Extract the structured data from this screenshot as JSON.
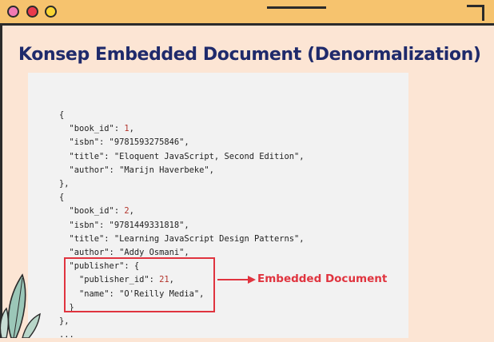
{
  "slide": {
    "title": "Konsep Embedded Document (Denormalization)",
    "annotation": "Embedded Document"
  },
  "code_lines": [
    "{",
    "  \"book_id\": 1,",
    "  \"isbn\": \"9781593275846\",",
    "  \"title\": \"Eloquent JavaScript, Second Edition\",",
    "  \"author\": \"Marijn Haverbeke\",",
    "},",
    "{",
    "  \"book_id\": 2,",
    "  \"isbn\": \"9781449331818\",",
    "  \"title\": \"Learning JavaScript Design Patterns\",",
    "  \"author\": \"Addy Osmani\",",
    "  \"publisher\": {",
    "    \"publisher_id\": 21,",
    "    \"name\": \"O'Reilly Media\",",
    "  }",
    "},",
    "..."
  ],
  "colors": {
    "background": "#fce5d4",
    "titlebar": "#f6c36e",
    "title_text": "#1f2a6b",
    "accent_red": "#e0343f",
    "code_bg": "#f2f2f2"
  },
  "window_controls": [
    "pink-dot",
    "red-dot",
    "yellow-dot"
  ]
}
